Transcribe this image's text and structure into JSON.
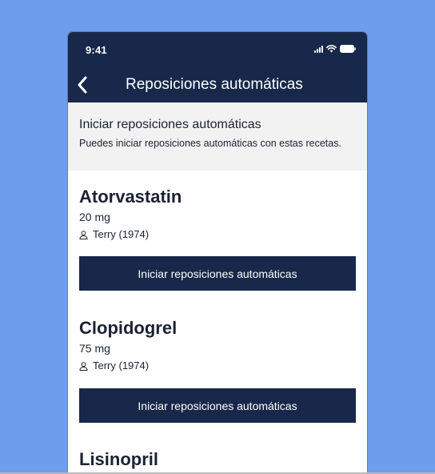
{
  "status_bar": {
    "time": "9:41",
    "icons": [
      "signal-icon",
      "wifi-icon",
      "battery-icon"
    ]
  },
  "nav": {
    "back_icon": "chevron-left-icon",
    "title": "Reposiciones automáticas"
  },
  "intro": {
    "title": "Iniciar reposiciones automáticas",
    "text": "Puedes iniciar reposiciones automáticas con estas recetas."
  },
  "medications": [
    {
      "name": "Atorvastatin",
      "dose": "20 mg",
      "patient": "Terry (1974)",
      "button_label": "Iniciar reposiciones automáticas"
    },
    {
      "name": "Clopidogrel",
      "dose": "75 mg",
      "patient": "Terry (1974)",
      "button_label": "Iniciar reposiciones automáticas"
    },
    {
      "name": "Lisinopril"
    }
  ],
  "colors": {
    "background": "#6f9ded",
    "header": "#17284a",
    "button": "#17284a",
    "intro_bg": "#f2f2f2"
  }
}
